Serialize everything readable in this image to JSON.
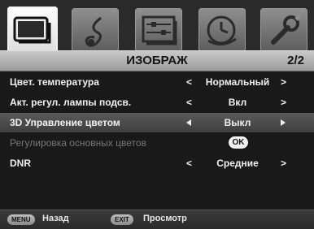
{
  "tabs": [
    {
      "name": "picture",
      "icon": "tv-icon",
      "active": true
    },
    {
      "name": "sound",
      "icon": "music-note-icon",
      "active": false
    },
    {
      "name": "setup",
      "icon": "sliders-icon",
      "active": false
    },
    {
      "name": "time",
      "icon": "clock-icon",
      "active": false
    },
    {
      "name": "settings",
      "icon": "wrench-icon",
      "active": false
    }
  ],
  "header": {
    "title": "ИЗОБРАЖ",
    "page": "2/2"
  },
  "rows": [
    {
      "label": "Цвет. температура",
      "left": "<",
      "value": "Нормальный",
      "right": ">"
    },
    {
      "label": "Акт. регул. лампы подсв.",
      "left": "<",
      "value": "Вкл",
      "right": ">"
    },
    {
      "label": "3D Управление цветом",
      "value": "Выкл",
      "highlighted": true
    },
    {
      "label": "Регулировка основных цветов",
      "ok": "OK",
      "disabled": true
    },
    {
      "label": "DNR",
      "left": "<",
      "value": "Средние",
      "right": ">"
    }
  ],
  "footer": {
    "menu_key": "MENU",
    "menu_label": "Назад",
    "exit_key": "EXIT",
    "exit_label": "Просмотр"
  }
}
